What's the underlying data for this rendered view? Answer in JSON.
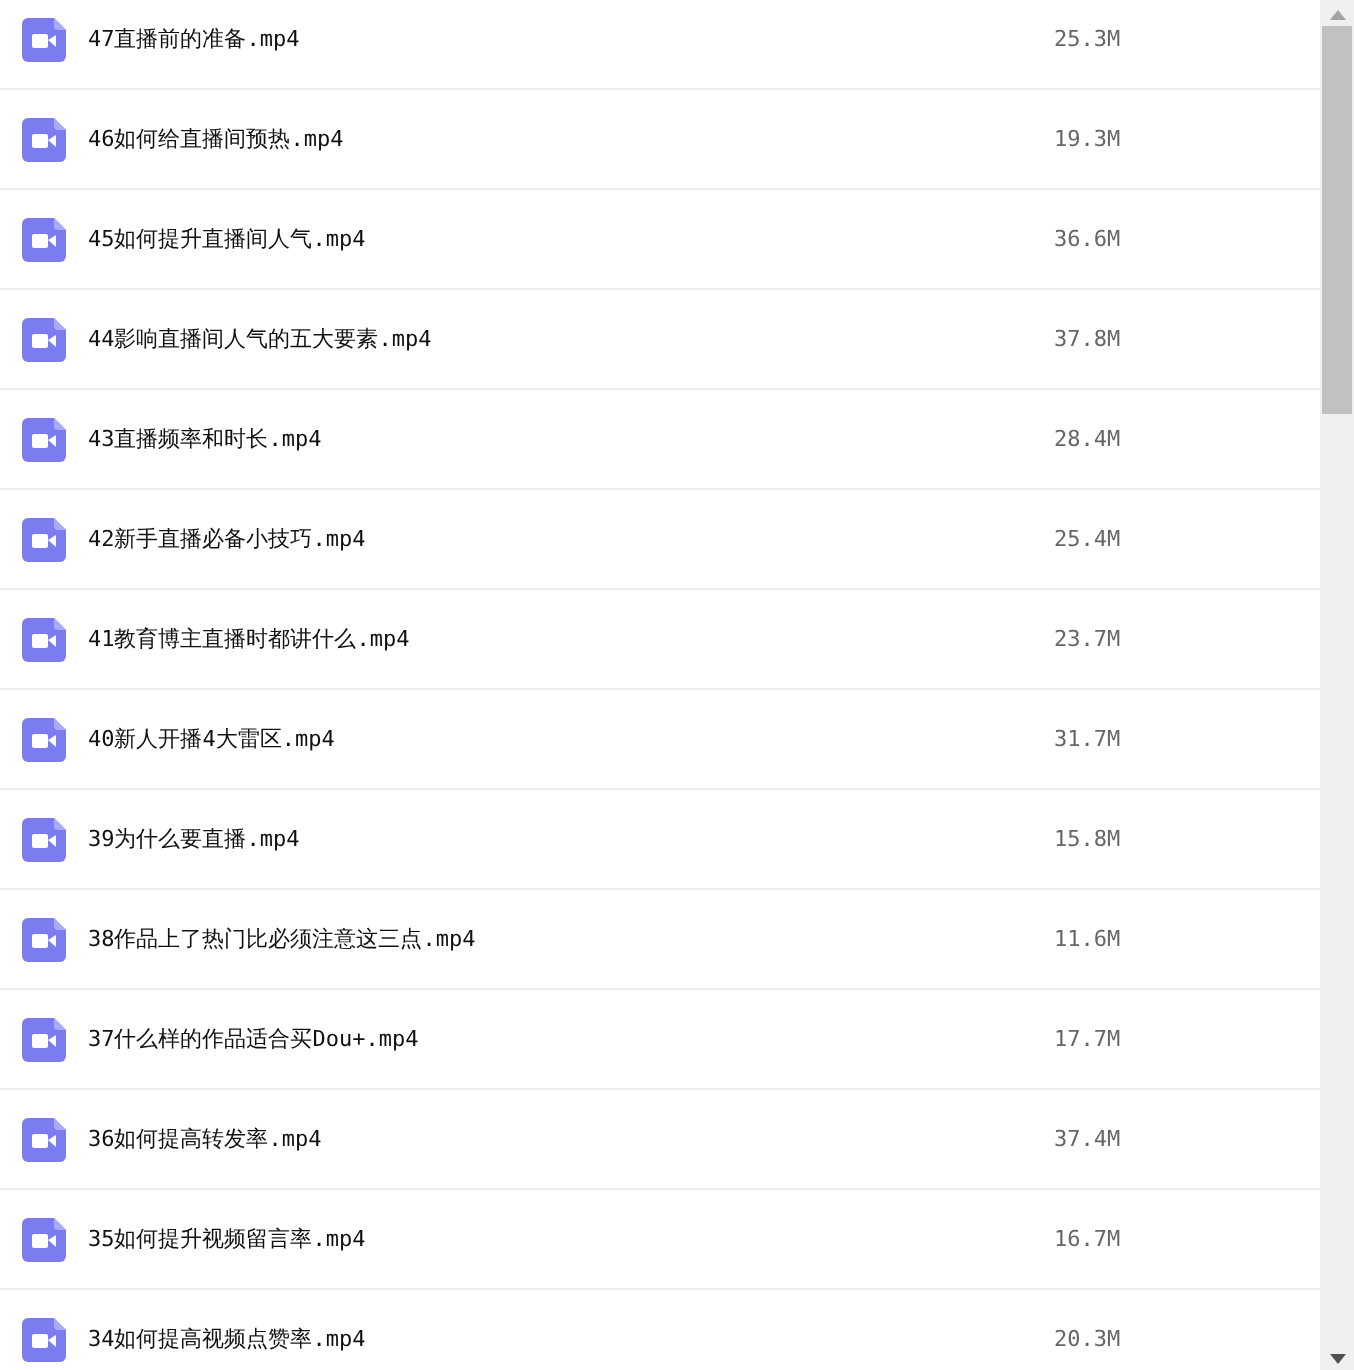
{
  "files": [
    {
      "name": "47直播前的准备.mp4",
      "size": "25.3M"
    },
    {
      "name": "46如何给直播间预热.mp4",
      "size": "19.3M"
    },
    {
      "name": "45如何提升直播间人气.mp4",
      "size": "36.6M"
    },
    {
      "name": "44影响直播间人气的五大要素.mp4",
      "size": "37.8M"
    },
    {
      "name": "43直播频率和时长.mp4",
      "size": "28.4M"
    },
    {
      "name": "42新手直播必备小技巧.mp4",
      "size": "25.4M"
    },
    {
      "name": "41教育博主直播时都讲什么.mp4",
      "size": "23.7M"
    },
    {
      "name": "40新人开播4大雷区.mp4",
      "size": "31.7M"
    },
    {
      "name": "39为什么要直播.mp4",
      "size": "15.8M"
    },
    {
      "name": "38作品上了热门比必须注意这三点.mp4",
      "size": "11.6M"
    },
    {
      "name": "37什么样的作品适合买Dou+.mp4",
      "size": "17.7M"
    },
    {
      "name": "36如何提高转发率.mp4",
      "size": "37.4M"
    },
    {
      "name": "35如何提升视频留言率.mp4",
      "size": "16.7M"
    },
    {
      "name": "34如何提高视频点赞率.mp4",
      "size": "20.3M"
    }
  ]
}
